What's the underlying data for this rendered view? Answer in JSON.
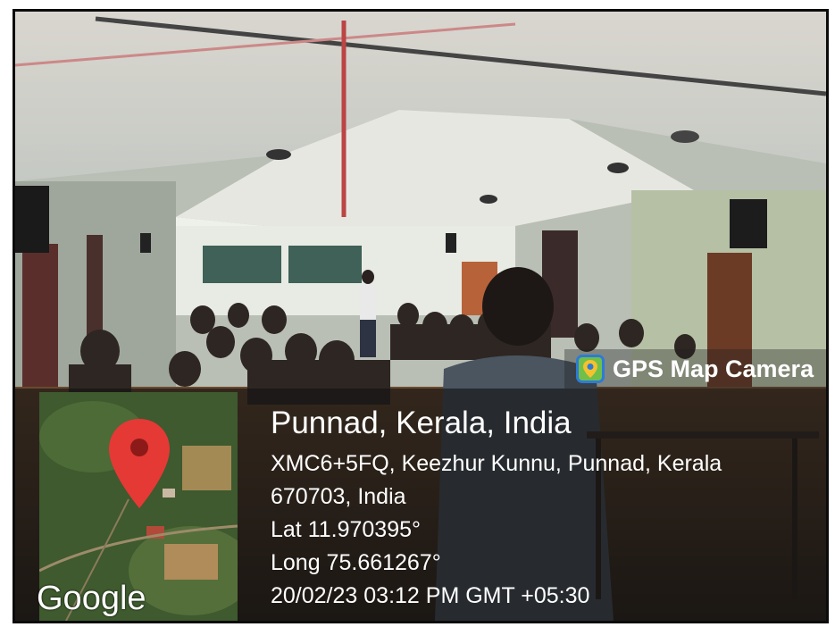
{
  "overlay": {
    "app_badge": "GPS Map Camera",
    "map_logo": "Google",
    "location_title": "Punnad, Kerala, India",
    "address_line1": "XMC6+5FQ, Keezhur Kunnu, Punnad, Kerala",
    "address_line2": "670703, India",
    "latitude": "Lat 11.970395°",
    "longitude": "Long 75.661267°",
    "datetime": "20/02/23 03:12 PM GMT +05:30"
  },
  "colors": {
    "pin_red": "#e53935",
    "badge_icon": "#2e7bd6"
  },
  "icons": [
    "gps-map-camera-icon",
    "map-pin-icon"
  ]
}
